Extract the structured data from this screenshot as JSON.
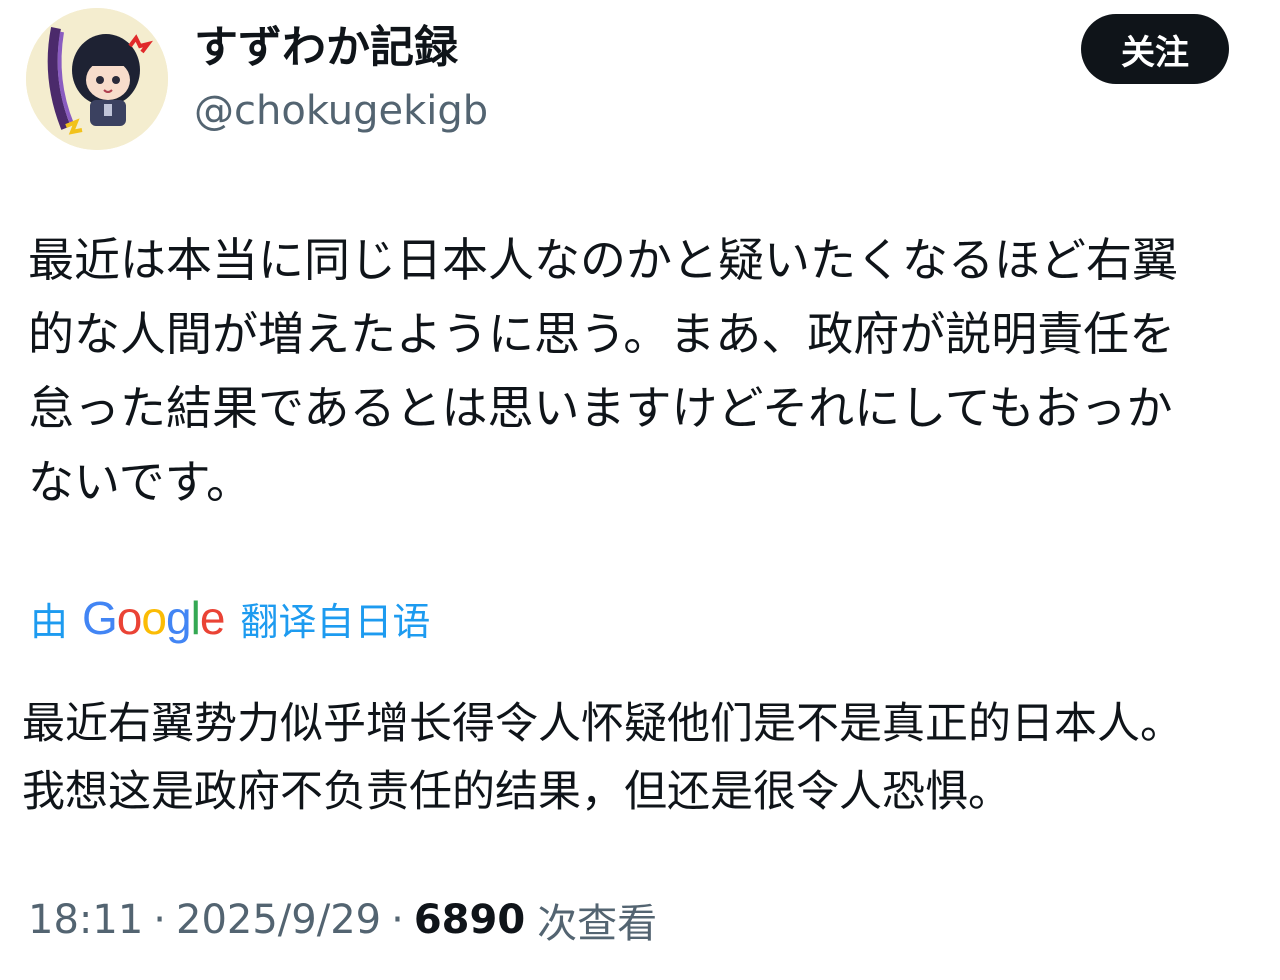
{
  "user": {
    "display_name": "すずわか記録",
    "handle": "@chokugekigb",
    "avatar_icon": "anime-character-avatar"
  },
  "follow_button": {
    "label": "关注"
  },
  "tweet": {
    "text": "最近は本当に同じ日本人なのかと疑いたくなるほど右翼的な人間が増えたように思う。まあ、政府が説明責任を怠った結果であるとは思いますけどそれにしてもおっかないです。"
  },
  "translation": {
    "by_label": "由",
    "google_logo": "Google",
    "source_label": "翻译自日语",
    "text": "最近右翼势力似乎增长得令人怀疑他们是不是真正的日本人。我想这是政府不负责任的结果，但还是很令人恐惧。"
  },
  "meta": {
    "time": "18:11",
    "date": "2025/9/29",
    "separator": "·",
    "view_count": "6890",
    "views_label": "次查看"
  },
  "colors": {
    "text_primary": "#0f1419",
    "text_secondary": "#536471",
    "link_blue": "#1d9bf0",
    "button_bg": "#0f1419"
  }
}
